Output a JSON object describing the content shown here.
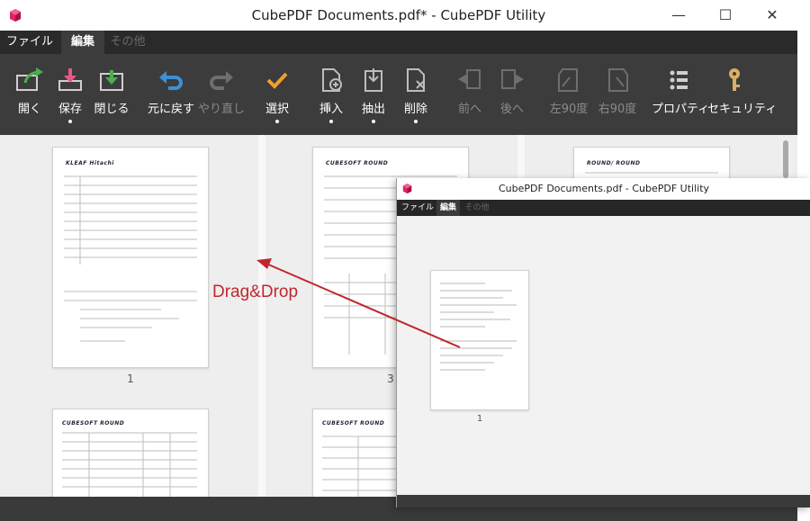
{
  "main_window": {
    "title": "CubePDF Documents.pdf* - CubePDF Utility",
    "menu": [
      {
        "label": "ファイル",
        "state": "normal"
      },
      {
        "label": "編集",
        "state": "active"
      },
      {
        "label": "その他",
        "state": "disabled"
      }
    ],
    "toolbar": [
      {
        "label": "開く",
        "icon": "open-icon",
        "enabled": true,
        "dropdown": false
      },
      {
        "label": "保存",
        "icon": "save-icon",
        "enabled": true,
        "dropdown": true
      },
      {
        "label": "閉じる",
        "icon": "close-doc-icon",
        "enabled": true,
        "dropdown": false
      },
      {
        "label": "元に戻す",
        "icon": "undo-icon",
        "enabled": true,
        "dropdown": false
      },
      {
        "label": "やり直し",
        "icon": "redo-icon",
        "enabled": false,
        "dropdown": false
      },
      {
        "label": "選択",
        "icon": "check-icon",
        "enabled": true,
        "dropdown": true
      },
      {
        "label": "挿入",
        "icon": "insert-icon",
        "enabled": true,
        "dropdown": true
      },
      {
        "label": "抽出",
        "icon": "extract-icon",
        "enabled": true,
        "dropdown": true
      },
      {
        "label": "削除",
        "icon": "delete-icon",
        "enabled": true,
        "dropdown": true
      },
      {
        "label": "前へ",
        "icon": "previous-icon",
        "enabled": false,
        "dropdown": false
      },
      {
        "label": "後へ",
        "icon": "next-icon",
        "enabled": false,
        "dropdown": false
      },
      {
        "label": "左90度",
        "icon": "rotate-left-icon",
        "enabled": false,
        "dropdown": false
      },
      {
        "label": "右90度",
        "icon": "rotate-right-icon",
        "enabled": false,
        "dropdown": false
      },
      {
        "label": "プロパティ",
        "icon": "properties-icon",
        "enabled": true,
        "dropdown": false
      },
      {
        "label": "セキュリティ",
        "icon": "key-icon",
        "enabled": true,
        "dropdown": false
      }
    ],
    "pages": [
      {
        "number": "1",
        "header": "KLEAF Hitachi"
      },
      {
        "number": "3",
        "header": "CUBESOFT ROUND"
      },
      {
        "number": "",
        "header": "ROUND/ ROUND"
      },
      {
        "number": "",
        "header": "CUBESOFT ROUND"
      },
      {
        "number": "",
        "header": "CUBESOFT ROUND"
      }
    ]
  },
  "second_window": {
    "title": "CubePDF Documents.pdf - CubePDF Utility",
    "menu": [
      {
        "label": "ファイル",
        "state": "normal"
      },
      {
        "label": "編集",
        "state": "active"
      },
      {
        "label": "その他",
        "state": "disabled"
      }
    ],
    "pages": [
      {
        "number": "1"
      }
    ]
  },
  "annotation": {
    "text": "Drag&Drop"
  },
  "colors": {
    "menubar": "#2a2a2a",
    "ribbon": "#3c3c3c",
    "accent_green": "#4caf50",
    "accent_pink": "#e8568a",
    "accent_blue": "#3d8fd8",
    "accent_orange": "#f0a030",
    "annotation_red": "#c0272d"
  }
}
